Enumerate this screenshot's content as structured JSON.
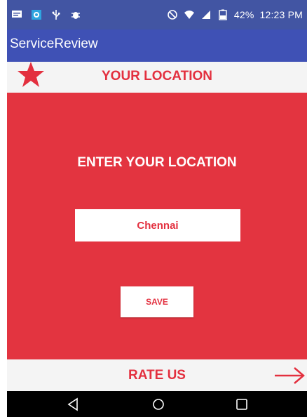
{
  "status_bar": {
    "battery": "42%",
    "time": "12:23 PM",
    "icons": [
      "message-icon",
      "gallery-icon",
      "usb-icon",
      "bug-icon",
      "do-not-disturb-icon",
      "wifi-icon",
      "signal-icon",
      "battery-icon"
    ]
  },
  "app_bar": {
    "title": "ServiceReview"
  },
  "location_header": {
    "title": "YOUR LOCATION",
    "icon": "star-icon"
  },
  "main": {
    "prompt": "ENTER YOUR LOCATION",
    "location_value": "Chennai",
    "save_label": "SAVE"
  },
  "rate_bar": {
    "label": "RATE US",
    "icon": "arrow-right-icon"
  },
  "nav_bar": {
    "icons": [
      "back-icon",
      "home-icon",
      "recents-icon"
    ]
  },
  "colors": {
    "status_bar": "#4255a3",
    "app_bar": "#3f51b5",
    "accent_red": "#e3303f",
    "panel_red": "#e33440",
    "light_bar": "#f4f4f4"
  }
}
